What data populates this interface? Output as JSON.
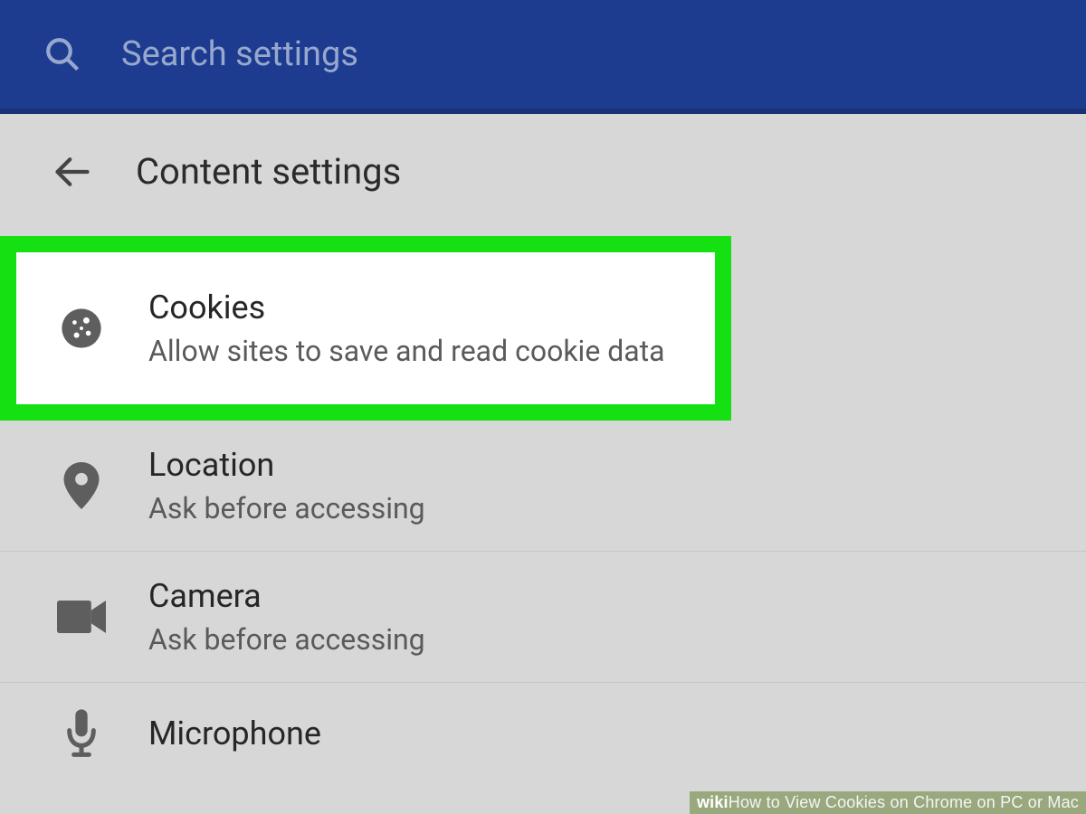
{
  "search": {
    "placeholder": "Search settings"
  },
  "header": {
    "title": "Content settings"
  },
  "rows": {
    "cookies": {
      "title": "Cookies",
      "sub": "Allow sites to save and read cookie data"
    },
    "location": {
      "title": "Location",
      "sub": "Ask before accessing"
    },
    "camera": {
      "title": "Camera",
      "sub": "Ask before accessing"
    },
    "microphone": {
      "title": "Microphone",
      "sub": ""
    }
  },
  "watermark": {
    "prefix": "wiki",
    "text": "How to View Cookies on Chrome on PC or Mac"
  }
}
